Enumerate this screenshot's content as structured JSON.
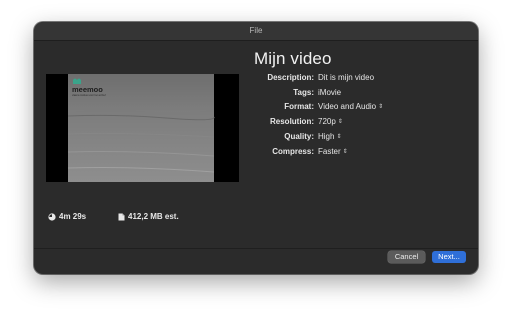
{
  "window": {
    "title": "File"
  },
  "preview": {
    "logo_text": "meemoo",
    "logo_subtext": "vlaams instituut voor het archief"
  },
  "heading": "Mijn video",
  "fields": {
    "description": {
      "label": "Description:",
      "value": "Dit is mijn video"
    },
    "tags": {
      "label": "Tags:",
      "value": "iMovie"
    },
    "format": {
      "label": "Format:",
      "value": "Video and Audio"
    },
    "resolution": {
      "label": "Resolution:",
      "value": "720p"
    },
    "quality": {
      "label": "Quality:",
      "value": "High"
    },
    "compress": {
      "label": "Compress:",
      "value": "Faster"
    }
  },
  "stats": {
    "duration": "4m 29s",
    "size": "412,2 MB est."
  },
  "buttons": {
    "cancel": "Cancel",
    "next": "Next..."
  },
  "icons": {
    "chevron": "updown-chevron-icon",
    "clock": "clock-icon",
    "file": "file-size-icon"
  },
  "colors": {
    "dialog_bg": "#2b2b2b",
    "accent": "#2f6fd8",
    "logo_green": "#3aa38a"
  }
}
